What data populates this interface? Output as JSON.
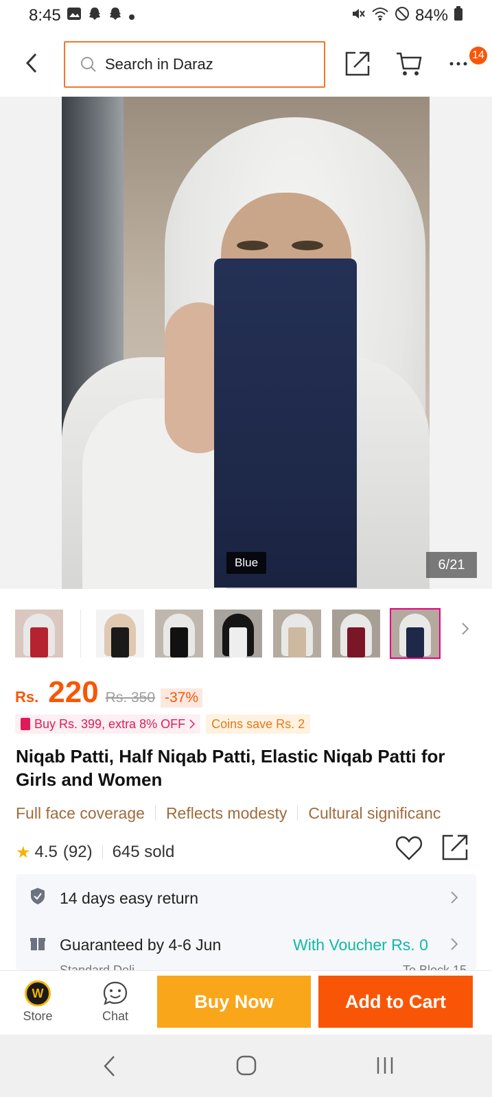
{
  "status_bar": {
    "time": "8:45",
    "battery": "84%"
  },
  "header": {
    "search_placeholder": "Search in Daraz",
    "badge_count": "14"
  },
  "gallery": {
    "color_label": "Blue",
    "counter": "6/21"
  },
  "thumbnails": [
    {
      "veil_color": "#b4232f"
    },
    {
      "veil_color": "#1a1a1a"
    },
    {
      "veil_color": "#111111"
    },
    {
      "veil_color": "#1c1c1c"
    },
    {
      "veil_color": "#cdb8a0"
    },
    {
      "veil_color": "#7a1626"
    },
    {
      "veil_color": "#1e2848"
    }
  ],
  "price": {
    "currency": "Rs.",
    "current": "220",
    "original": "Rs. 350",
    "discount": "-37%"
  },
  "promos": {
    "bundle": "Buy Rs. 399, extra 8% OFF",
    "coins": "Coins save Rs. 2"
  },
  "product": {
    "title": "Niqab Patti, Half Niqab Patti, Elastic Niqab Patti for Girls and Women",
    "tags": [
      "Full face coverage",
      "Reflects modesty",
      "Cultural significanc"
    ]
  },
  "rating": {
    "score": "4.5",
    "reviews": "(92)",
    "sold": "645 sold"
  },
  "service": {
    "return_text": "14 days easy return",
    "delivery_text": "Guaranteed by 4-6 Jun",
    "voucher_text": "With Voucher Rs. 0",
    "delivery_sub": "Standard Deli",
    "delivery_sub_right": "To Block 15"
  },
  "bottom_bar": {
    "store_label": "Store",
    "chat_label": "Chat",
    "buy_now": "Buy Now",
    "add_to_cart": "Add to Cart"
  },
  "colors": {
    "accent": "#f85606",
    "buy_now": "#faa61a",
    "voucher": "#11b9a2",
    "tag": "#a06a3c"
  }
}
